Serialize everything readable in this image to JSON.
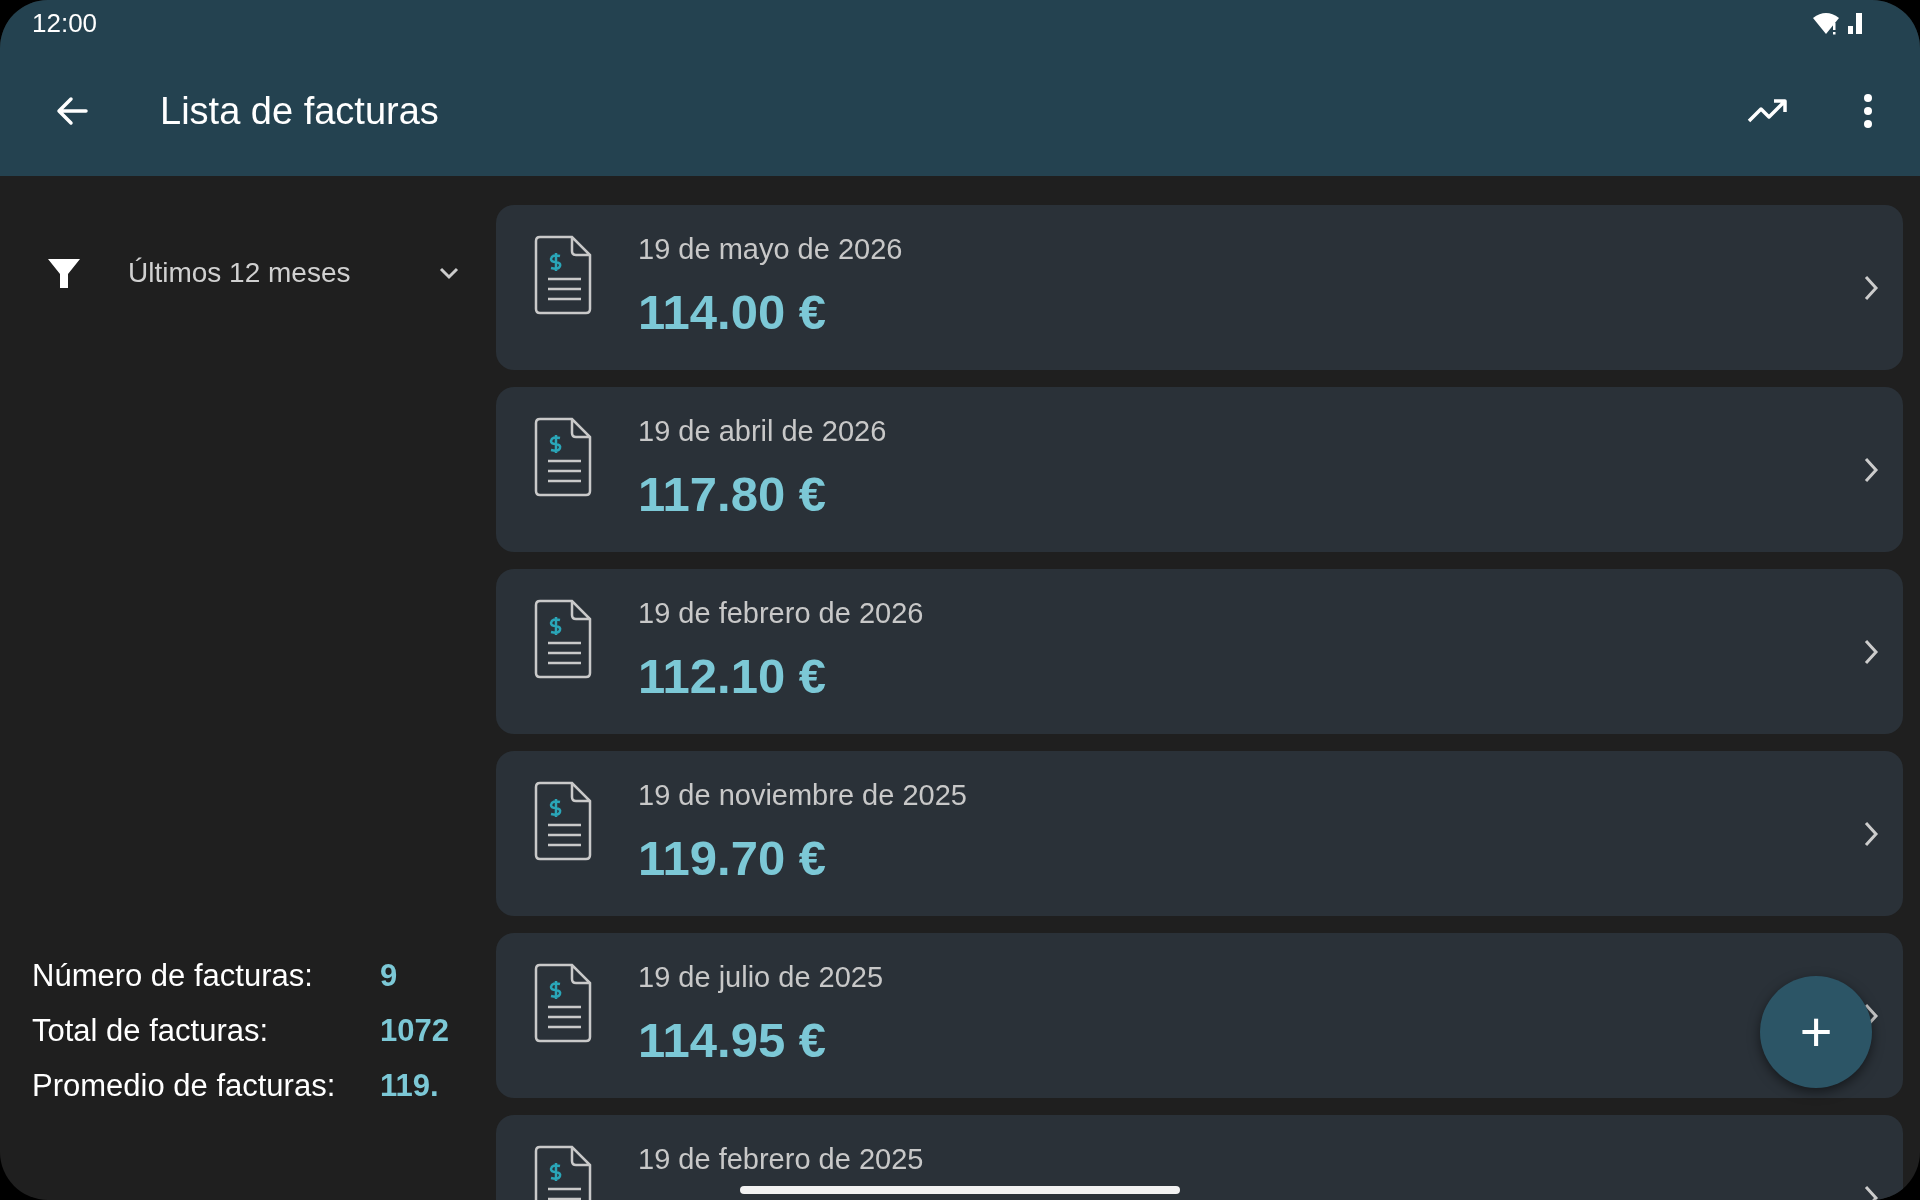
{
  "status_bar": {
    "time": "12:00"
  },
  "app_bar": {
    "title": "Lista de facturas"
  },
  "filter": {
    "label": "Últimos 12 meses"
  },
  "stats": [
    {
      "label": "Número de facturas:",
      "value": "9"
    },
    {
      "label": "Total de facturas:",
      "value": "1072"
    },
    {
      "label": "Promedio de facturas:",
      "value": "119."
    }
  ],
  "invoices": [
    {
      "date": "19 de mayo de 2026",
      "amount": "114.00 €"
    },
    {
      "date": "19 de abril de 2026",
      "amount": "117.80 €"
    },
    {
      "date": "19 de febrero de 2026",
      "amount": "112.10 €"
    },
    {
      "date": "19 de noviembre de 2025",
      "amount": "119.70 €"
    },
    {
      "date": "19 de julio de 2025",
      "amount": "114.95 €"
    },
    {
      "date": "19 de febrero de 2025"
    }
  ],
  "fab": {
    "label": "+"
  }
}
